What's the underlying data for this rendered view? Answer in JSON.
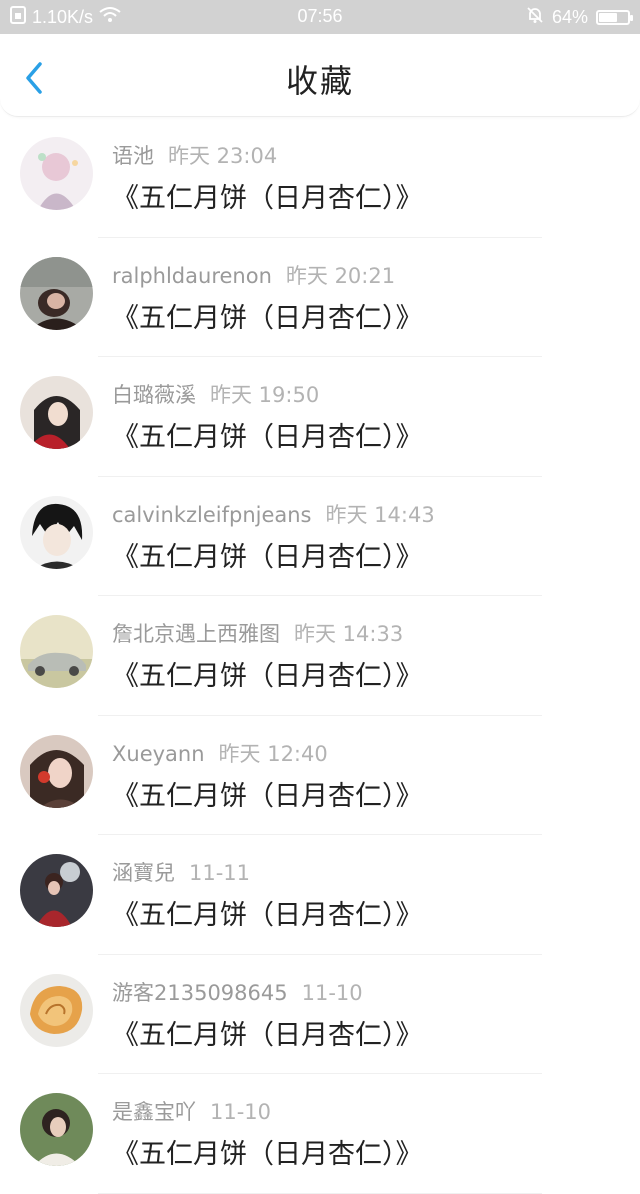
{
  "status_bar": {
    "network_speed": "1.10K/s",
    "time": "07:56",
    "battery": "64%",
    "battery_level": 0.64
  },
  "nav": {
    "title": "收藏"
  },
  "items": [
    {
      "user": "语池",
      "time": "昨天 23:04",
      "title": "《五仁月饼（日月杏仁）》"
    },
    {
      "user": "ralphldaurenon",
      "time": "昨天 20:21",
      "title": "《五仁月饼（日月杏仁）》"
    },
    {
      "user": "白璐薇溪",
      "time": "昨天 19:50",
      "title": "《五仁月饼（日月杏仁）》"
    },
    {
      "user": "calvinkzleifpnjeans",
      "time": "昨天 14:43",
      "title": "《五仁月饼（日月杏仁）》"
    },
    {
      "user": "詹北京遇上西雅图",
      "time": "昨天 14:33",
      "title": "《五仁月饼（日月杏仁）》"
    },
    {
      "user": "Xueyann",
      "time": "昨天 12:40",
      "title": "《五仁月饼（日月杏仁）》"
    },
    {
      "user": "涵寶兒",
      "time": "11-11",
      "title": "《五仁月饼（日月杏仁）》"
    },
    {
      "user": "游客2135098645",
      "time": "11-10",
      "title": "《五仁月饼（日月杏仁）》"
    },
    {
      "user": "是鑫宝吖",
      "time": "11-10",
      "title": "《五仁月饼（日月杏仁）》"
    }
  ]
}
